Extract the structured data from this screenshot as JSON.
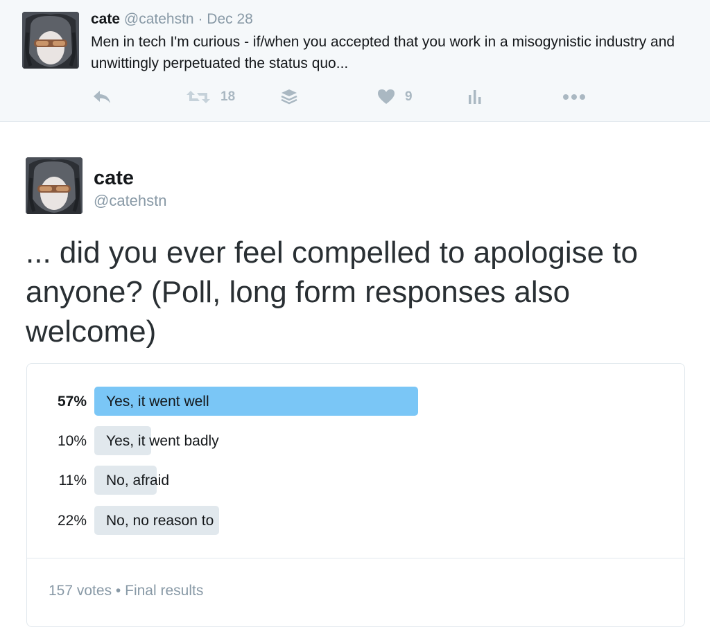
{
  "parent_tweet": {
    "name": "cate",
    "handle": "@catehstn",
    "separator": "·",
    "date": "Dec 28",
    "text": "Men in tech I'm curious - if/when you accepted that you work in a misogynistic industry and unwittingly perpetuated the status quo...",
    "actions": {
      "reply_icon": "reply-icon",
      "retweet_icon": "retweet-icon",
      "retweet_count": "18",
      "buffer_icon": "buffer-icon",
      "like_icon": "heart-icon",
      "like_count": "9",
      "analytics_icon": "analytics-icon",
      "more_icon": "more-dots-icon"
    }
  },
  "main_tweet": {
    "name": "cate",
    "handle": "@catehstn",
    "text": "... did you ever feel compelled to apologise to anyone? (Poll, long form responses also welcome)"
  },
  "poll": {
    "choices": [
      {
        "percent_label": "57%",
        "label": "Yes, it went well",
        "value": 57,
        "winner": true
      },
      {
        "percent_label": "10%",
        "label": "Yes, it went badly",
        "value": 10,
        "winner": false
      },
      {
        "percent_label": "11%",
        "label": "No, afraid",
        "value": 11,
        "winner": false
      },
      {
        "percent_label": "22%",
        "label": "No, no reason to",
        "value": 22,
        "winner": false
      }
    ],
    "footer": {
      "votes": "157 votes",
      "separator": "•",
      "status": "Final results"
    },
    "colors": {
      "winner_bar": "#7ac6f6",
      "other_bar": "#e1e8ed"
    }
  },
  "colors": {
    "text": "#14171a",
    "muted": "#8899a6",
    "icon": "#aab8c2",
    "parent_bg": "#f5f8fa"
  }
}
